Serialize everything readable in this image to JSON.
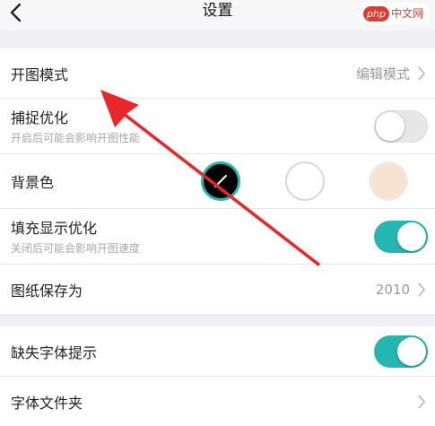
{
  "nav": {
    "title": "设置",
    "back_icon": "chevron-left-icon"
  },
  "watermark": {
    "logo": "php",
    "text": "中文网"
  },
  "section1": {
    "open_mode": {
      "label": "开图模式",
      "value": "编辑模式"
    },
    "capture": {
      "label": "捕捉优化",
      "sub": "开启后可能会影响开图性能",
      "enabled": false
    },
    "background": {
      "label": "背景色",
      "options": [
        "#000000",
        "#ffffff",
        "#f8e3d3"
      ],
      "selected": "#000000"
    },
    "fill": {
      "label": "填充显示优化",
      "sub": "关闭后可能会影响开图速度",
      "enabled": true
    },
    "save_as": {
      "label": "图纸保存为",
      "value": "2010"
    }
  },
  "section2": {
    "missing_font": {
      "label": "缺失字体提示",
      "enabled": true
    },
    "font_folder": {
      "label": "字体文件夹"
    }
  },
  "colors": {
    "accent": "#26b6b1",
    "annotation_arrow": "#e8272b"
  }
}
